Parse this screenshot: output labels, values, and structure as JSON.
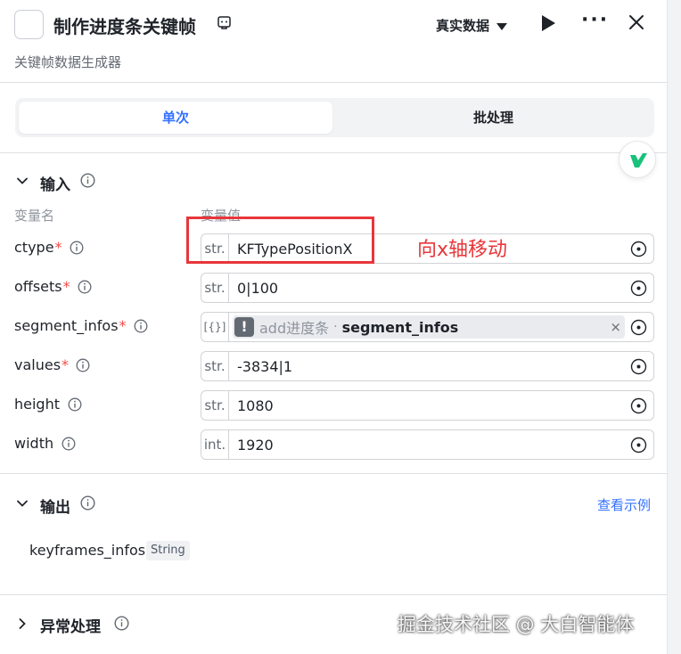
{
  "header": {
    "title": "制作进度条关键帧",
    "subtitle": "关键帧数据生成器",
    "data_mode": "真实数据"
  },
  "tabs": [
    {
      "label": "单次",
      "active": true
    },
    {
      "label": "批处理",
      "active": false
    }
  ],
  "input_section": {
    "title": "输入",
    "col_name": "变量名",
    "col_value": "变量值",
    "rows": [
      {
        "name": "ctype",
        "required": "*",
        "type": "str.",
        "value": "KFTypePositionX"
      },
      {
        "name": "offsets",
        "required": "*",
        "type": "str.",
        "value": "0|100"
      },
      {
        "name": "segment_infos",
        "required": "*",
        "type": "[{}]",
        "ref_icon": "!",
        "ref_node": "add进度条",
        "ref_sep": "·",
        "ref_var": "segment_infos",
        "ref_clear": "×"
      },
      {
        "name": "values",
        "required": "*",
        "type": "str.",
        "value": "-3834|1"
      },
      {
        "name": "height",
        "required": "",
        "type": "str.",
        "value": "1080"
      },
      {
        "name": "width",
        "required": "",
        "type": "int.",
        "value": "1920"
      }
    ]
  },
  "annotation": {
    "text": "向x轴移动",
    "color": "#e8363a"
  },
  "output_section": {
    "title": "输出",
    "example_link": "查看示例",
    "outputs": [
      {
        "name": "keyframes_infos",
        "type": "String"
      }
    ]
  },
  "error_section": {
    "title": "异常处理"
  },
  "watermark": "掘金技术社区 @ 大白智能体",
  "colors": {
    "accent": "#3370ff",
    "required": "#f54a45",
    "annotation": "#e8363a"
  }
}
